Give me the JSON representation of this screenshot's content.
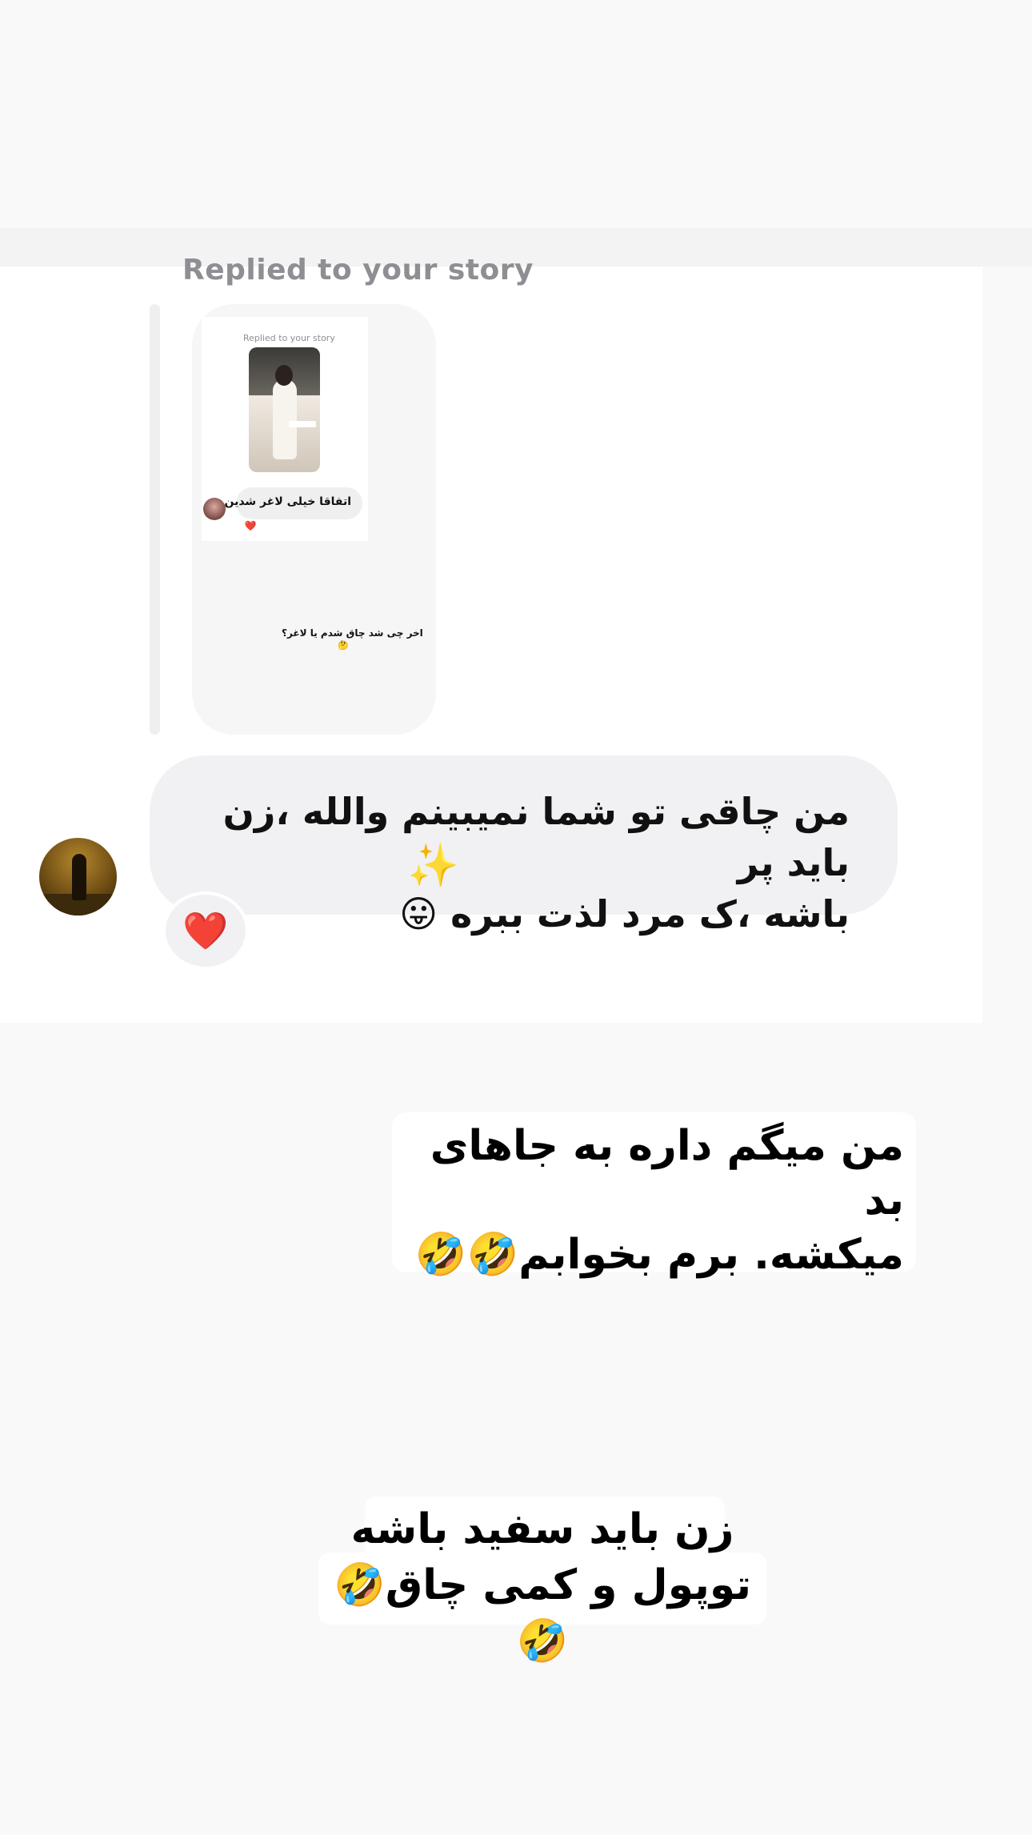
{
  "story_reply": {
    "header": "Replied to your story",
    "nested": {
      "header": "Replied to your story",
      "message": "اتفاقا خیلی لاغر شدین",
      "reaction": "❤️"
    },
    "caption": "اخر چی شد چاق شدم یا لاغر؟",
    "caption_emoji": "🤔"
  },
  "message": {
    "text": "من چاقی تو شما نمیبینم والله ،زن باید پر\nباشه ،ک مرد لذت ببره 😛",
    "reaction": "❤️",
    "sticker": "✨"
  },
  "overlay_captions": [
    "من میگم داره به جاهای بد\nمیکشه. برم بخوابم🤣🤣",
    "زن باید سفید باشه\nتوپول و کمی چاق🤣🤣"
  ],
  "icons": {
    "reaction": "heart-icon",
    "sticker": "sparkles-icon",
    "avatar": "sender-avatar"
  }
}
